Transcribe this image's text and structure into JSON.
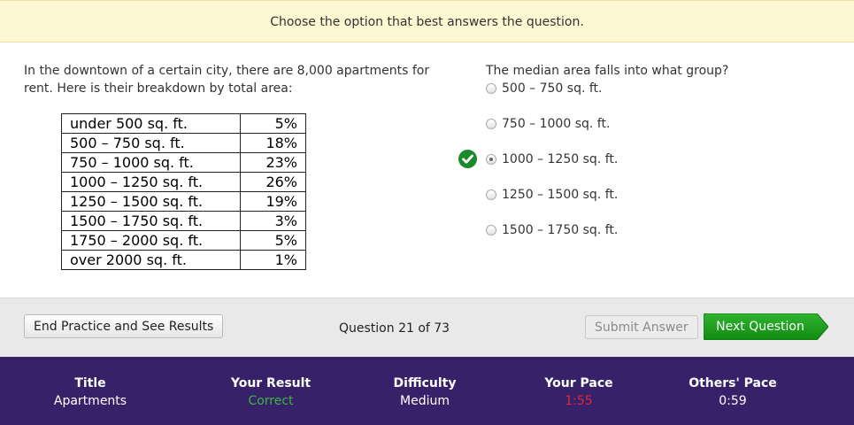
{
  "instruction": "Choose the option that best answers the question.",
  "passage": "In the downtown of a certain city, there are 8,000 apartments for rent. Here is their breakdown by total area:",
  "table": [
    {
      "label": "under 500 sq. ft.",
      "pct": "5%"
    },
    {
      "label": "500 – 750 sq. ft.",
      "pct": "18%"
    },
    {
      "label": "750 – 1000 sq. ft.",
      "pct": "23%"
    },
    {
      "label": "1000 – 1250 sq. ft.",
      "pct": "26%"
    },
    {
      "label": "1250 – 1500 sq. ft.",
      "pct": "19%"
    },
    {
      "label": "1500 – 1750 sq. ft.",
      "pct": "3%"
    },
    {
      "label": "1750 – 2000 sq. ft.",
      "pct": "5%"
    },
    {
      "label": "over 2000 sq. ft.",
      "pct": "1%"
    }
  ],
  "question": "The median area falls into what group?",
  "options": [
    {
      "label": "500 – 750 sq. ft.",
      "selected": false
    },
    {
      "label": "750 – 1000 sq. ft.",
      "selected": false
    },
    {
      "label": "1000 – 1250 sq. ft.",
      "selected": true
    },
    {
      "label": "1250 – 1500 sq. ft.",
      "selected": false
    },
    {
      "label": "1500 – 1750 sq. ft.",
      "selected": false
    }
  ],
  "toolbar": {
    "end_label": "End Practice and See Results",
    "question_count": "Question 21 of 73",
    "submit_label": "Submit Answer",
    "next_label": "Next Question"
  },
  "footer": {
    "title_h": "Title",
    "title_v": "Apartments",
    "result_h": "Your Result",
    "result_v": "Correct",
    "difficulty_h": "Difficulty",
    "difficulty_v": "Medium",
    "pace_h": "Your Pace",
    "pace_v": "1:55",
    "others_h": "Others' Pace",
    "others_v": "0:59"
  },
  "colors": {
    "instruction_bg": "#fdf7d2",
    "correct_green": "#1a8a2a",
    "next_button": "#169a16",
    "footer_bg": "#37226a",
    "result_color": "#3fb63f",
    "pace_color": "#e0283a"
  },
  "icons": {
    "correct": "check-circle-icon"
  }
}
